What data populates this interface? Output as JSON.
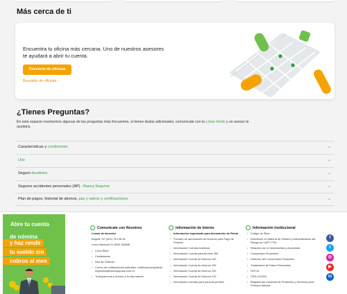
{
  "cerca": {
    "title": "Más cerca de ti",
    "text": "Encuentra tu oficina más cercana. Uno de nuestros asesores te ayudará a abrir tu cuenta.",
    "button": "Directorio de oficinas",
    "link": "Buscador de oficinas ›"
  },
  "faq_intro": {
    "title": "¿Tienes Preguntas?",
    "text_before": "En este espacio resolvemos algunas de las preguntas más frecuentes, si tienes dudas adicionales, comunícate con la ",
    "link": "Línea Verde",
    "text_after": " y un asesor te ayudará."
  },
  "faqs": [
    {
      "plain": "Características y ",
      "green": "condiciones"
    },
    {
      "plain": "",
      "green": "Uso"
    },
    {
      "plain": "Seguro ",
      "green": "deudores"
    },
    {
      "plain": "Seguros accidentes personales (AP) - ",
      "green": "Banca Seguros"
    },
    {
      "plain": "Plan de pagos, historial de abonos, ",
      "green": "paz y salvos y certificaciones"
    }
  ],
  "chevron": "⌄",
  "promo": {
    "line1": "Abre tu cuenta",
    "line2": "de nómina",
    "band1": "y haz rendir",
    "band2": "tu sueldo sin",
    "band3": "cobros al mes"
  },
  "footer": {
    "col1": {
      "title": "Comunícate con Nosotros",
      "lineas_label": "Líneas de atención",
      "bogota": "Bogotá +57 (601) 743 46 46",
      "nacional": "Línea Nacional 01 8000 184646",
      "items": [
        "Línea Ética",
        "Contáctanos",
        "Red de Oficinas",
        "Correo de notificaciones judiciales: notificacionesjudicialesjuridica@bancopopular.com.co",
        "Transparencia y Acceso a la Información"
      ]
    },
    "col2": {
      "title": "Información de Interés",
      "items": [
        "Información importante para declaración de Renta",
        "Formato de autorización de terceros para Pago de Pensión",
        "Información Cuentas Inactivas",
        "Información Cuenta para Ahorrar 260",
        "Información Cuenta de Ahorros 240",
        "Información Cuenta de Ahorros 230",
        "Información Cuenta de Ahorros 220",
        "Información Cuenta de Ahorros 210",
        "Información cuentas para persona jurídica"
      ]
    },
    "col3": {
      "title": "Información institucional",
      "items": [
        "Código de Ética",
        "Directrices en Materia de Gestión y Administración del Riesgo de LA/FT FPa",
        "Relación con el Inversionista y Accionista",
        "Consumidor Financiero",
        "Defensor del Consumidor Financiero",
        "Tratamiento de Datos Personales",
        "FATCA",
        "CRS (OCDE)",
        "Reglamento Universal de Productos y Servicios para Persona Natural"
      ]
    }
  },
  "social": [
    {
      "icon": "facebook-icon",
      "glyph": "f",
      "color": "#3b5998"
    },
    {
      "icon": "twitter-icon",
      "glyph": "t",
      "color": "#1da1f2"
    },
    {
      "icon": "instagram-icon",
      "glyph": "◎",
      "color": "#d6249f"
    },
    {
      "icon": "youtube-icon",
      "glyph": "▶",
      "color": "#e52d27"
    },
    {
      "icon": "linkedin-icon",
      "glyph": "in",
      "color": "#0a66c2"
    }
  ],
  "colors": {
    "green": "#2e9e3e",
    "orange": "#f5a300",
    "promo_green": "#6fc14b"
  }
}
